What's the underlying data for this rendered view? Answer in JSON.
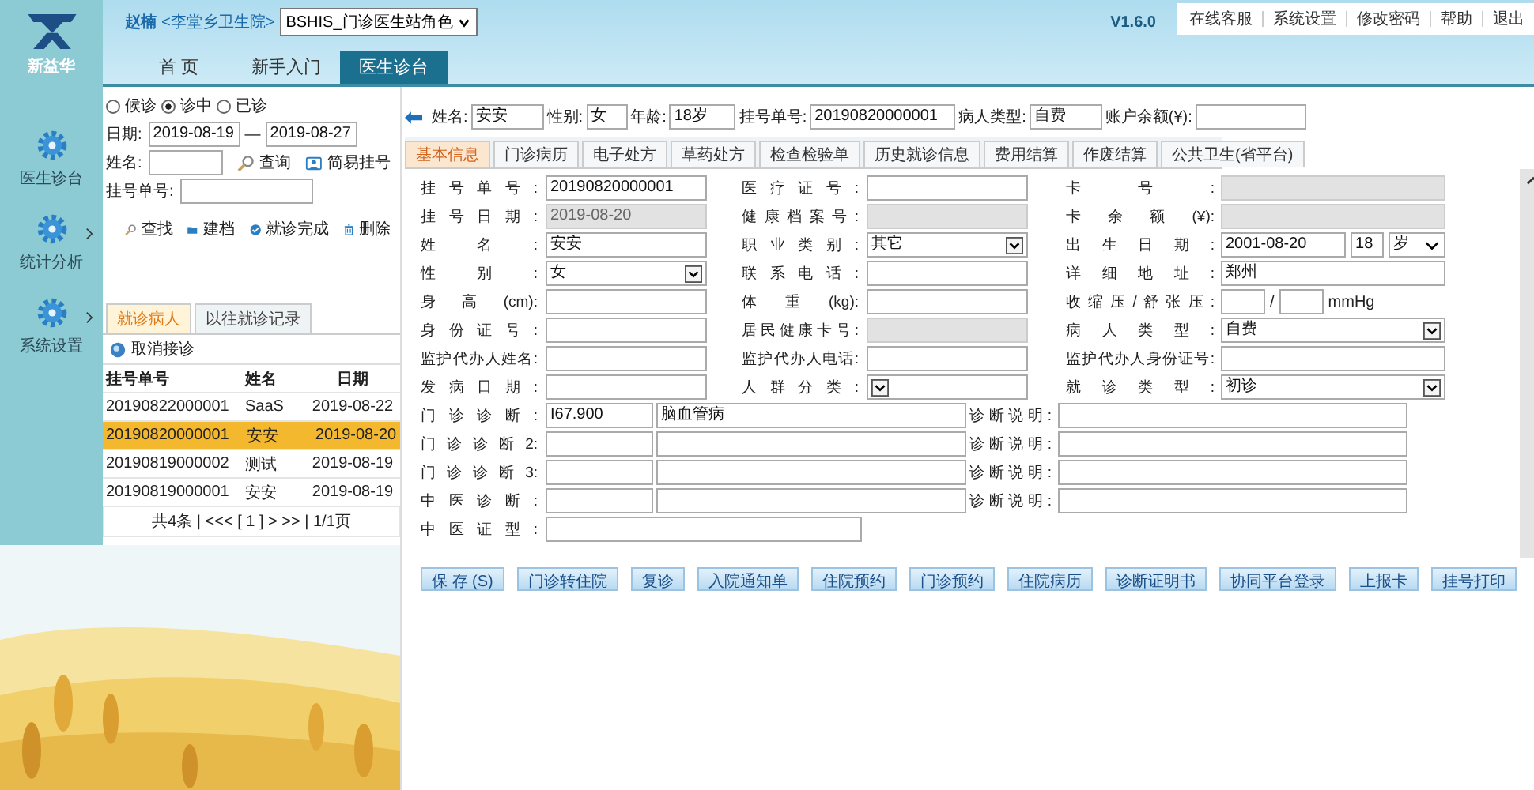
{
  "logo_text": "新益华",
  "header": {
    "user": "赵楠",
    "org": "<李堂乡卫生院>",
    "role": "BSHIS_门诊医生站角色",
    "version": "V1.6.0",
    "links": [
      "在线客服",
      "系统设置",
      "修改密码",
      "帮助",
      "退出"
    ]
  },
  "main_tabs": [
    {
      "label": "首 页",
      "selected": false
    },
    {
      "label": "新手入门",
      "selected": false
    },
    {
      "label": "医生诊台",
      "selected": true
    }
  ],
  "rail": [
    {
      "label": "医生诊台",
      "has_submenu": false
    },
    {
      "label": "统计分析",
      "has_submenu": true
    },
    {
      "label": "系统设置",
      "has_submenu": true
    }
  ],
  "left": {
    "status": [
      {
        "label": "候诊",
        "selected": false
      },
      {
        "label": "诊中",
        "selected": true
      },
      {
        "label": "已诊",
        "selected": false
      }
    ],
    "date_label": "日期:",
    "date_from": "2019-08-19",
    "date_sep": "—",
    "date_to": "2019-08-27",
    "name_label": "姓名:",
    "query": "查询",
    "easy_reg": "简易挂号",
    "reg_label": "挂号单号:",
    "actions": [
      {
        "label": "查找",
        "kind": "search"
      },
      {
        "label": "建档",
        "kind": "folder"
      },
      {
        "label": "就诊完成",
        "kind": "check"
      },
      {
        "label": "删除",
        "kind": "trash"
      }
    ],
    "tabs": [
      {
        "label": "就诊病人",
        "selected": true
      },
      {
        "label": "以往就诊记录",
        "selected": false
      }
    ],
    "cancel": "取消接诊",
    "columns": [
      "挂号单号",
      "姓名",
      "日期"
    ],
    "rows": [
      {
        "cells": [
          "20190822000001",
          "SaaS",
          "2019-08-22"
        ],
        "selected": false
      },
      {
        "cells": [
          "20190820000001",
          "安安",
          "2019-08-20"
        ],
        "selected": true
      },
      {
        "cells": [
          "20190819000002",
          "测试",
          "2019-08-19"
        ],
        "selected": false
      },
      {
        "cells": [
          "20190819000001",
          "安安",
          "2019-08-19"
        ],
        "selected": false
      }
    ],
    "pager": "共4条 | <<< [ 1 ] > >> | 1/1页"
  },
  "patient_bar": [
    {
      "label": "姓名:",
      "value": "安安"
    },
    {
      "label": "性别:",
      "value": "女"
    },
    {
      "label": "年龄:",
      "value": "18岁"
    },
    {
      "label": "挂号单号:",
      "value": "20190820000001"
    },
    {
      "label": "病人类型:",
      "value": "自费"
    },
    {
      "label": "账户余额(¥):"
    }
  ],
  "form_tabs": [
    {
      "label": "基本信息",
      "selected": true
    },
    {
      "label": "门诊病历",
      "selected": false
    },
    {
      "label": "电子处方",
      "selected": false
    },
    {
      "label": "草药处方",
      "selected": false
    },
    {
      "label": "检查检验单",
      "selected": false
    },
    {
      "label": "历史就诊信息",
      "selected": false
    },
    {
      "label": "费用结算",
      "selected": false
    },
    {
      "label": "作废结算",
      "selected": false
    },
    {
      "label": "公共卫生(省平台)",
      "selected": false
    }
  ],
  "form_rows": [
    [
      {
        "label": "挂号单号:",
        "kind": "text",
        "value": "20190820000001"
      },
      {
        "label": "医疗证号:",
        "kind": "text"
      },
      {
        "label": "卡号:",
        "kind": "readonly"
      }
    ],
    [
      {
        "label": "挂号日期:",
        "kind": "readonly",
        "value": "2019-08-20"
      },
      {
        "label": "健康档案号:",
        "kind": "readonly"
      },
      {
        "label": "卡余额(¥):",
        "kind": "readonly"
      }
    ],
    [
      {
        "label": "姓名:",
        "kind": "text",
        "value": "安安"
      },
      {
        "label": "职业类别:",
        "kind": "select",
        "value": "其它"
      },
      {
        "label": "出生日期:",
        "kind": "birth",
        "value": "2001-08-20",
        "age": "18",
        "unit": "岁"
      }
    ],
    [
      {
        "label": "性别:",
        "kind": "select",
        "value": "女"
      },
      {
        "label": "联系电话:",
        "kind": "text"
      },
      {
        "label": "详细地址:",
        "kind": "text",
        "value": "郑州"
      }
    ],
    [
      {
        "label": "身高(cm):",
        "kind": "text"
      },
      {
        "label": "体重(kg):",
        "kind": "text"
      },
      {
        "label": "收缩压/舒张压:",
        "kind": "bp",
        "sep": "/",
        "unit": "mmHg"
      }
    ],
    [
      {
        "label": "身份证号:",
        "kind": "text"
      },
      {
        "label": "居民健康卡号:",
        "kind": "readonly"
      },
      {
        "label": "病人类型:",
        "kind": "select",
        "value": "自费"
      }
    ],
    [
      {
        "label": "监护代办人姓名:",
        "kind": "text"
      },
      {
        "label": "监护代办人电话:",
        "kind": "text"
      },
      {
        "label": "监护代办人身份证号:",
        "kind": "text"
      }
    ],
    [
      {
        "label": "发病日期:",
        "kind": "text"
      },
      {
        "label": "人群分类:",
        "kind": "select"
      },
      {
        "label": "就诊类型:",
        "kind": "select",
        "value": "初诊"
      }
    ]
  ],
  "diagnoses": [
    {
      "label": "门诊诊断:",
      "code": "I67.900",
      "name": "脑血管病",
      "note_label": "诊断说明:"
    },
    {
      "label": "门诊诊断2:",
      "note_label": "诊断说明:"
    },
    {
      "label": "门诊诊断3:",
      "note_label": "诊断说明:"
    },
    {
      "label": "中医诊断:",
      "note_label": "诊断说明:"
    }
  ],
  "tcm_label": "中医证型:",
  "buttons": [
    "保 存 (S)",
    "门诊转住院",
    "复诊",
    "入院通知单",
    "住院预约",
    "门诊预约",
    "住院病历",
    "诊断证明书",
    "协同平台登录",
    "上报卡",
    "挂号打印"
  ]
}
